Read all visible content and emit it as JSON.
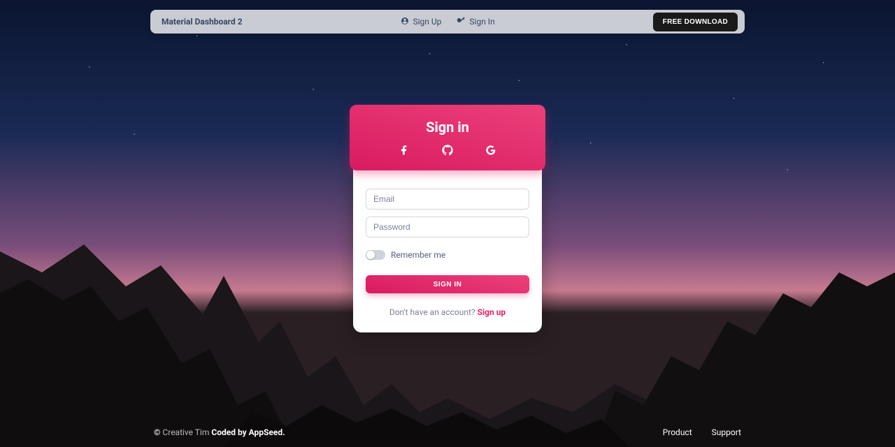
{
  "navbar": {
    "brand": "Material Dashboard 2",
    "links": [
      {
        "label": "Sign Up"
      },
      {
        "label": "Sign In"
      }
    ],
    "cta": "FREE DOWNLOAD"
  },
  "card": {
    "title": "Sign in",
    "email_placeholder": "Email",
    "password_placeholder": "Password",
    "remember_label": "Remember me",
    "submit_label": "SIGN IN",
    "no_account_text": "Don't have an account? ",
    "signup_link": "Sign up"
  },
  "footer": {
    "copyright_symbol": "©",
    "creative_tim": "Creative Tim",
    "coded_by": " Coded by AppSeed.",
    "links": [
      {
        "label": "Product"
      },
      {
        "label": "Support"
      }
    ]
  }
}
